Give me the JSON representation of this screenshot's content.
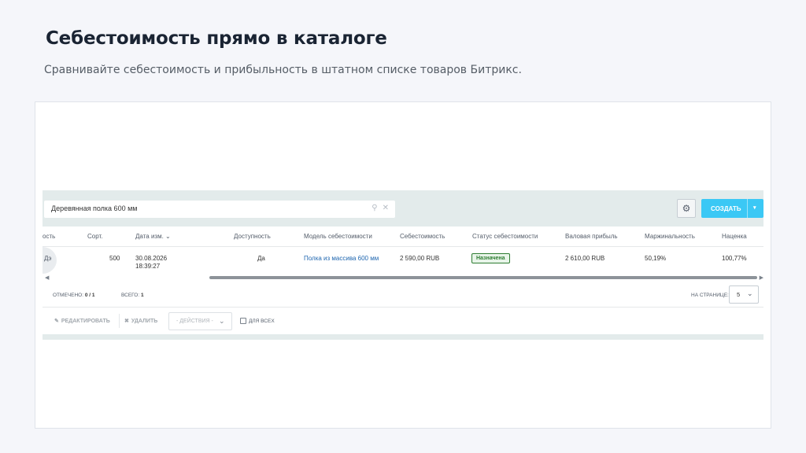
{
  "header": {
    "title": "Себестоимость прямо в каталоге",
    "subtitle": "Сравнивайте себестоимость и прибыльность в штатном списке товаров Битрикс."
  },
  "filter": {
    "value": "Деревянная полка 600 мм"
  },
  "toolbar": {
    "create_label": "СОЗДАТЬ"
  },
  "columns": [
    "ость",
    "Сорт.",
    "Дата изм.",
    "Доступность",
    "Модель себестоимости",
    "Себестоимость",
    "Статус себестоимости",
    "Валовая прибыль",
    "Маржинальность",
    "Наценка"
  ],
  "row": {
    "name_fragment": "Дэ",
    "sort": "500",
    "date": "30.08.2026",
    "time": "18:39:27",
    "availability": "Да",
    "model": "Полка из массива 600 мм",
    "cost": "2 590,00 RUB",
    "status": "Назначена",
    "gross_profit": "2 610,00 RUB",
    "margin": "50,19%",
    "markup": "100,77%"
  },
  "footer": {
    "marked_label": "ОТМЕЧЕНО:",
    "marked_value": "0 / 1",
    "total_label": "ВСЕГО:",
    "total_value": "1",
    "per_page_label": "НА СТРАНИЦЕ:",
    "per_page_value": "5"
  },
  "actions": {
    "edit": "РЕДАКТИРОВАТЬ",
    "delete": "УДАЛИТЬ",
    "select_placeholder": "- ДЕЙСТВИЯ -",
    "for_all": "ДЛЯ ВСЕХ"
  },
  "colors": {
    "accent": "#3bc8f5",
    "toolbar_bg": "#e3ebeb",
    "link": "#2067b0",
    "status_green": "#2e7d32"
  }
}
